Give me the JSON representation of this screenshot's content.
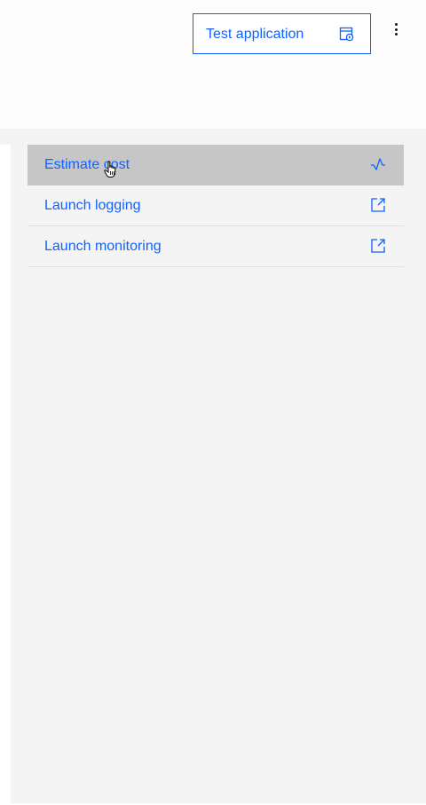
{
  "header": {
    "test_button_label": "Test application",
    "test_button_icon": "app-test-icon",
    "overflow_icon": "overflow-menu-vertical-icon"
  },
  "menu": {
    "items": [
      {
        "label": "Estimate cost",
        "icon": "activity-icon",
        "active": true
      },
      {
        "label": "Launch logging",
        "icon": "launch-icon",
        "active": false
      },
      {
        "label": "Launch monitoring",
        "icon": "launch-icon",
        "active": false
      }
    ]
  },
  "colors": {
    "accent": "#0f62fe",
    "hover_background": "#c6c6c6",
    "panel_background": "#f4f4f4"
  }
}
